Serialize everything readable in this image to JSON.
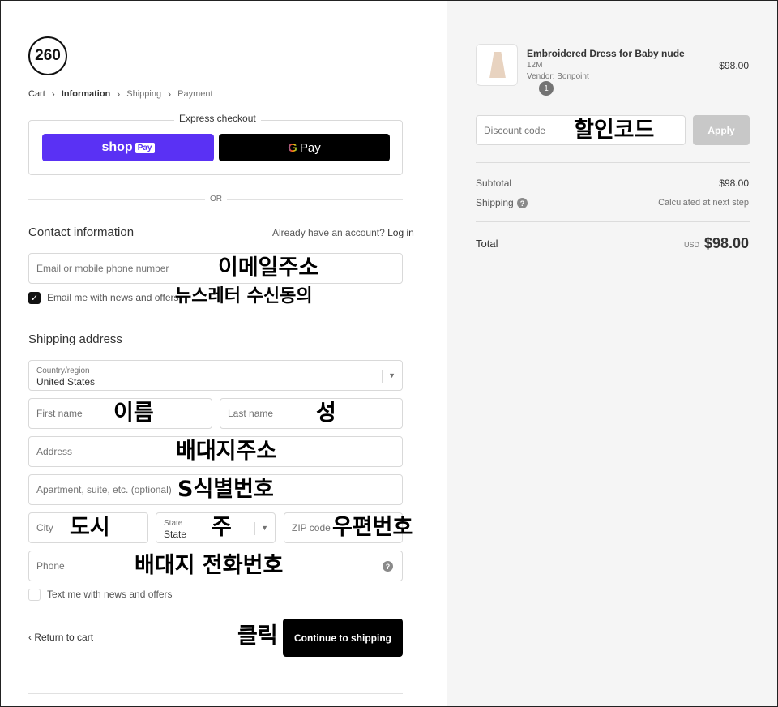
{
  "logo": {
    "text": "260"
  },
  "breadcrumb": {
    "items": [
      "Cart",
      "Information",
      "Shipping",
      "Payment"
    ],
    "separator": "›"
  },
  "express": {
    "title": "Express checkout",
    "shop_label": "shop",
    "shop_pay_badge": "Pay",
    "gpay_g": "G",
    "gpay_label": "Pay"
  },
  "or_text": "OR",
  "contact": {
    "title": "Contact information",
    "account_prompt": "Already have an account?",
    "login_link": "Log in",
    "email_placeholder": "Email or mobile phone number",
    "news_checkbox_label": "Email me with news and offers"
  },
  "shipping": {
    "title": "Shipping address",
    "country_label": "Country/region",
    "country_value": "United States",
    "first_name": "First name",
    "last_name": "Last name",
    "address": "Address",
    "apartment": "Apartment, suite, etc. (optional)",
    "city": "City",
    "state_label": "State",
    "state_value": "State",
    "zip": "ZIP code",
    "phone": "Phone",
    "sms_checkbox_label": "Text me with news and offers"
  },
  "annotations": {
    "email": "이메일주소",
    "news": "뉴스레터 수신동의",
    "first_name": "이름",
    "last_name": "성",
    "address": "배대지주소",
    "apartment": "S식별번호",
    "city": "도시",
    "state": "주",
    "zip": "우편번호",
    "phone": "배대지 전화번호",
    "click": "클릭",
    "discount": "할인코드"
  },
  "actions": {
    "return_label": "Return to cart",
    "return_chevron": "‹",
    "continue_label": "Continue to shipping"
  },
  "cart": {
    "quantity": "1",
    "item_name": "Embroidered Dress for Baby nude",
    "item_size": "12M",
    "item_vendor": "Vendor: Bonpoint",
    "item_price": "$98.00",
    "discount_placeholder": "Discount code",
    "apply_label": "Apply",
    "subtotal_label": "Subtotal",
    "subtotal_value": "$98.00",
    "shipping_label": "Shipping",
    "shipping_value": "Calculated at next step",
    "total_label": "Total",
    "total_currency": "USD",
    "total_value": "$98.00"
  },
  "icons": {
    "help": "?",
    "check": "✓",
    "caret": "▼"
  }
}
